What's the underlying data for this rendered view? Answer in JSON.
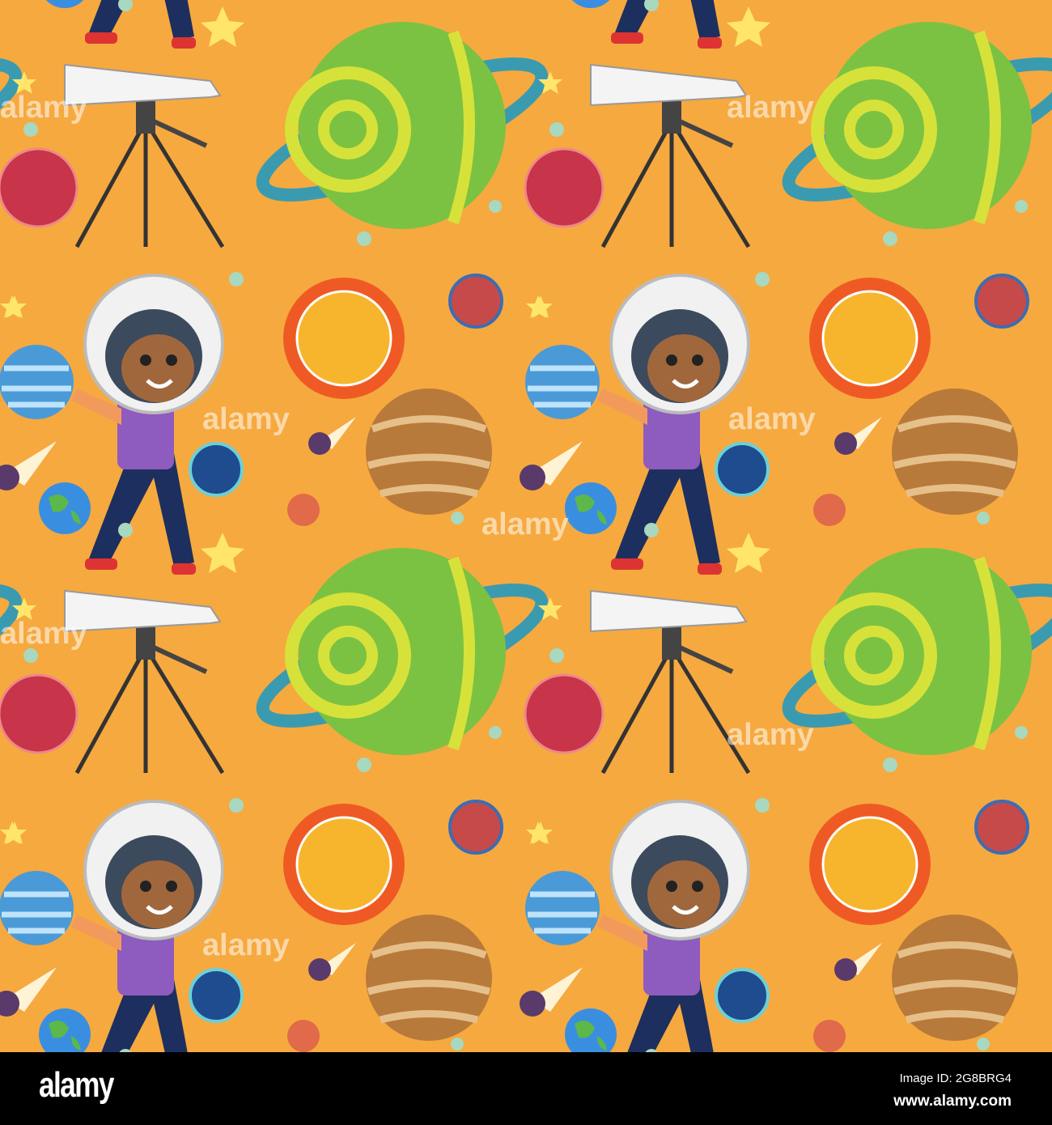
{
  "watermark": {
    "text": "alamy"
  },
  "footer": {
    "logo": "alamy",
    "image_id": "Image ID: 2G8BRG4",
    "website": "www.alamy.com"
  },
  "colors": {
    "background": "#f6a93f",
    "saturn": "#7cc242",
    "ring": "#3a9bb0",
    "sun": "#f7b52d",
    "red_planet": "#c8344a",
    "blue_planet": "#4a9ad8",
    "brown_planet": "#b87a3a",
    "shirt": "#8e5bbf",
    "pants": "#1d2f5e"
  }
}
